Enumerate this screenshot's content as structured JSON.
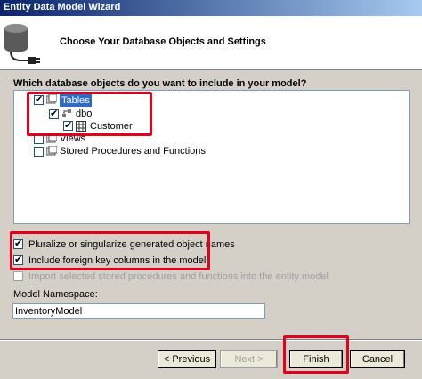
{
  "window": {
    "title": "Entity Data Model Wizard"
  },
  "header": {
    "title": "Choose Your Database Objects and Settings"
  },
  "question": "Which database objects do you want to include in your model?",
  "tree": {
    "tables": {
      "label": "Tables",
      "checked": true
    },
    "schema": {
      "label": "dbo",
      "checked": true
    },
    "table": {
      "label": "Customer",
      "checked": true
    },
    "views": {
      "label": "Views",
      "checked": false
    },
    "procs": {
      "label": "Stored Procedures and Functions",
      "checked": false
    }
  },
  "options": {
    "pluralize": {
      "label": "Pluralize or singularize generated object names",
      "checked": true
    },
    "foreign_keys": {
      "label": "Include foreign key columns in the model",
      "checked": true
    },
    "import_procs": {
      "label": "Import selected stored procedures and functions into the entity model",
      "checked": false,
      "disabled": true
    }
  },
  "namespace": {
    "label": "Model Namespace:",
    "value": "InventoryModel"
  },
  "buttons": {
    "previous": "< Previous",
    "next": "Next >",
    "finish": "Finish",
    "cancel": "Cancel"
  },
  "highlight_color": "#e2001a",
  "selection_color": "#316ac5"
}
